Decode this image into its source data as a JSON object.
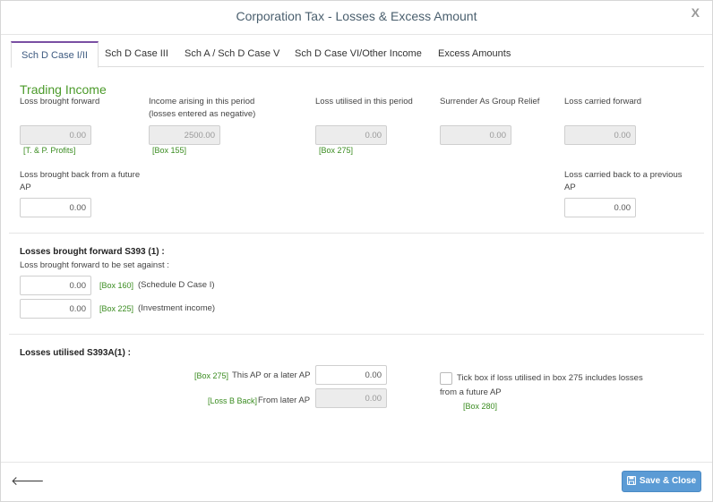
{
  "header": {
    "title": "Corporation Tax - Losses & Excess Amount",
    "close_label": "X"
  },
  "tabs": [
    {
      "label": "Sch D Case I/II"
    },
    {
      "label": "Sch D Case III"
    },
    {
      "label": "Sch A / Sch D Case V"
    },
    {
      "label": "Sch D Case VI/Other Income"
    },
    {
      "label": "Excess Amounts"
    }
  ],
  "trading": {
    "heading": "Trading Income",
    "lbf_label": "Loss brought forward",
    "lbf_value": "0.00",
    "lbf_box": "[T. & P. Profits]",
    "income_label_1": "Income arising in this period",
    "income_label_2": "(losses entered as negative)",
    "income_value": "2500.00",
    "income_box": "[Box 155]",
    "utilised_label": "Loss utilised in this period",
    "utilised_value": "0.00",
    "utilised_box": "[Box 275]",
    "surrender_label": "Surrender As Group Relief",
    "surrender_value": "0.00",
    "lcf_label": "Loss carried forward",
    "lcf_value": "0.00",
    "lbb_label_1": "Loss brought back from a future",
    "lbb_label_2": "AP",
    "lbb_value": "0.00",
    "lcb_label_1": "Loss carried back to a previous",
    "lcb_label_2": "AP",
    "lcb_value": "0.00"
  },
  "s393": {
    "heading": "Losses brought forward S393 (1) :",
    "sub": "Loss brought forward to be set against :",
    "row1_value": "0.00",
    "row1_box": "[Box 160]",
    "row1_text": "(Schedule D Case I)",
    "row2_value": "0.00",
    "row2_box": "[Box 225]",
    "row2_text": "(Investment income)"
  },
  "s393a": {
    "heading": "Losses utilised S393A(1) :",
    "row1_box": "[Box 275]",
    "row1_text": "This AP or a later AP",
    "row1_value": "0.00",
    "row2_box": "[Loss B Back]",
    "row2_text": "From later AP",
    "row2_value": "0.00",
    "tick_line_1": "Tick box if loss utilised in box 275 includes losses",
    "tick_line_2": "from a future AP",
    "tick_box": "[Box 280]"
  },
  "footer": {
    "save_label": "Save & Close"
  }
}
